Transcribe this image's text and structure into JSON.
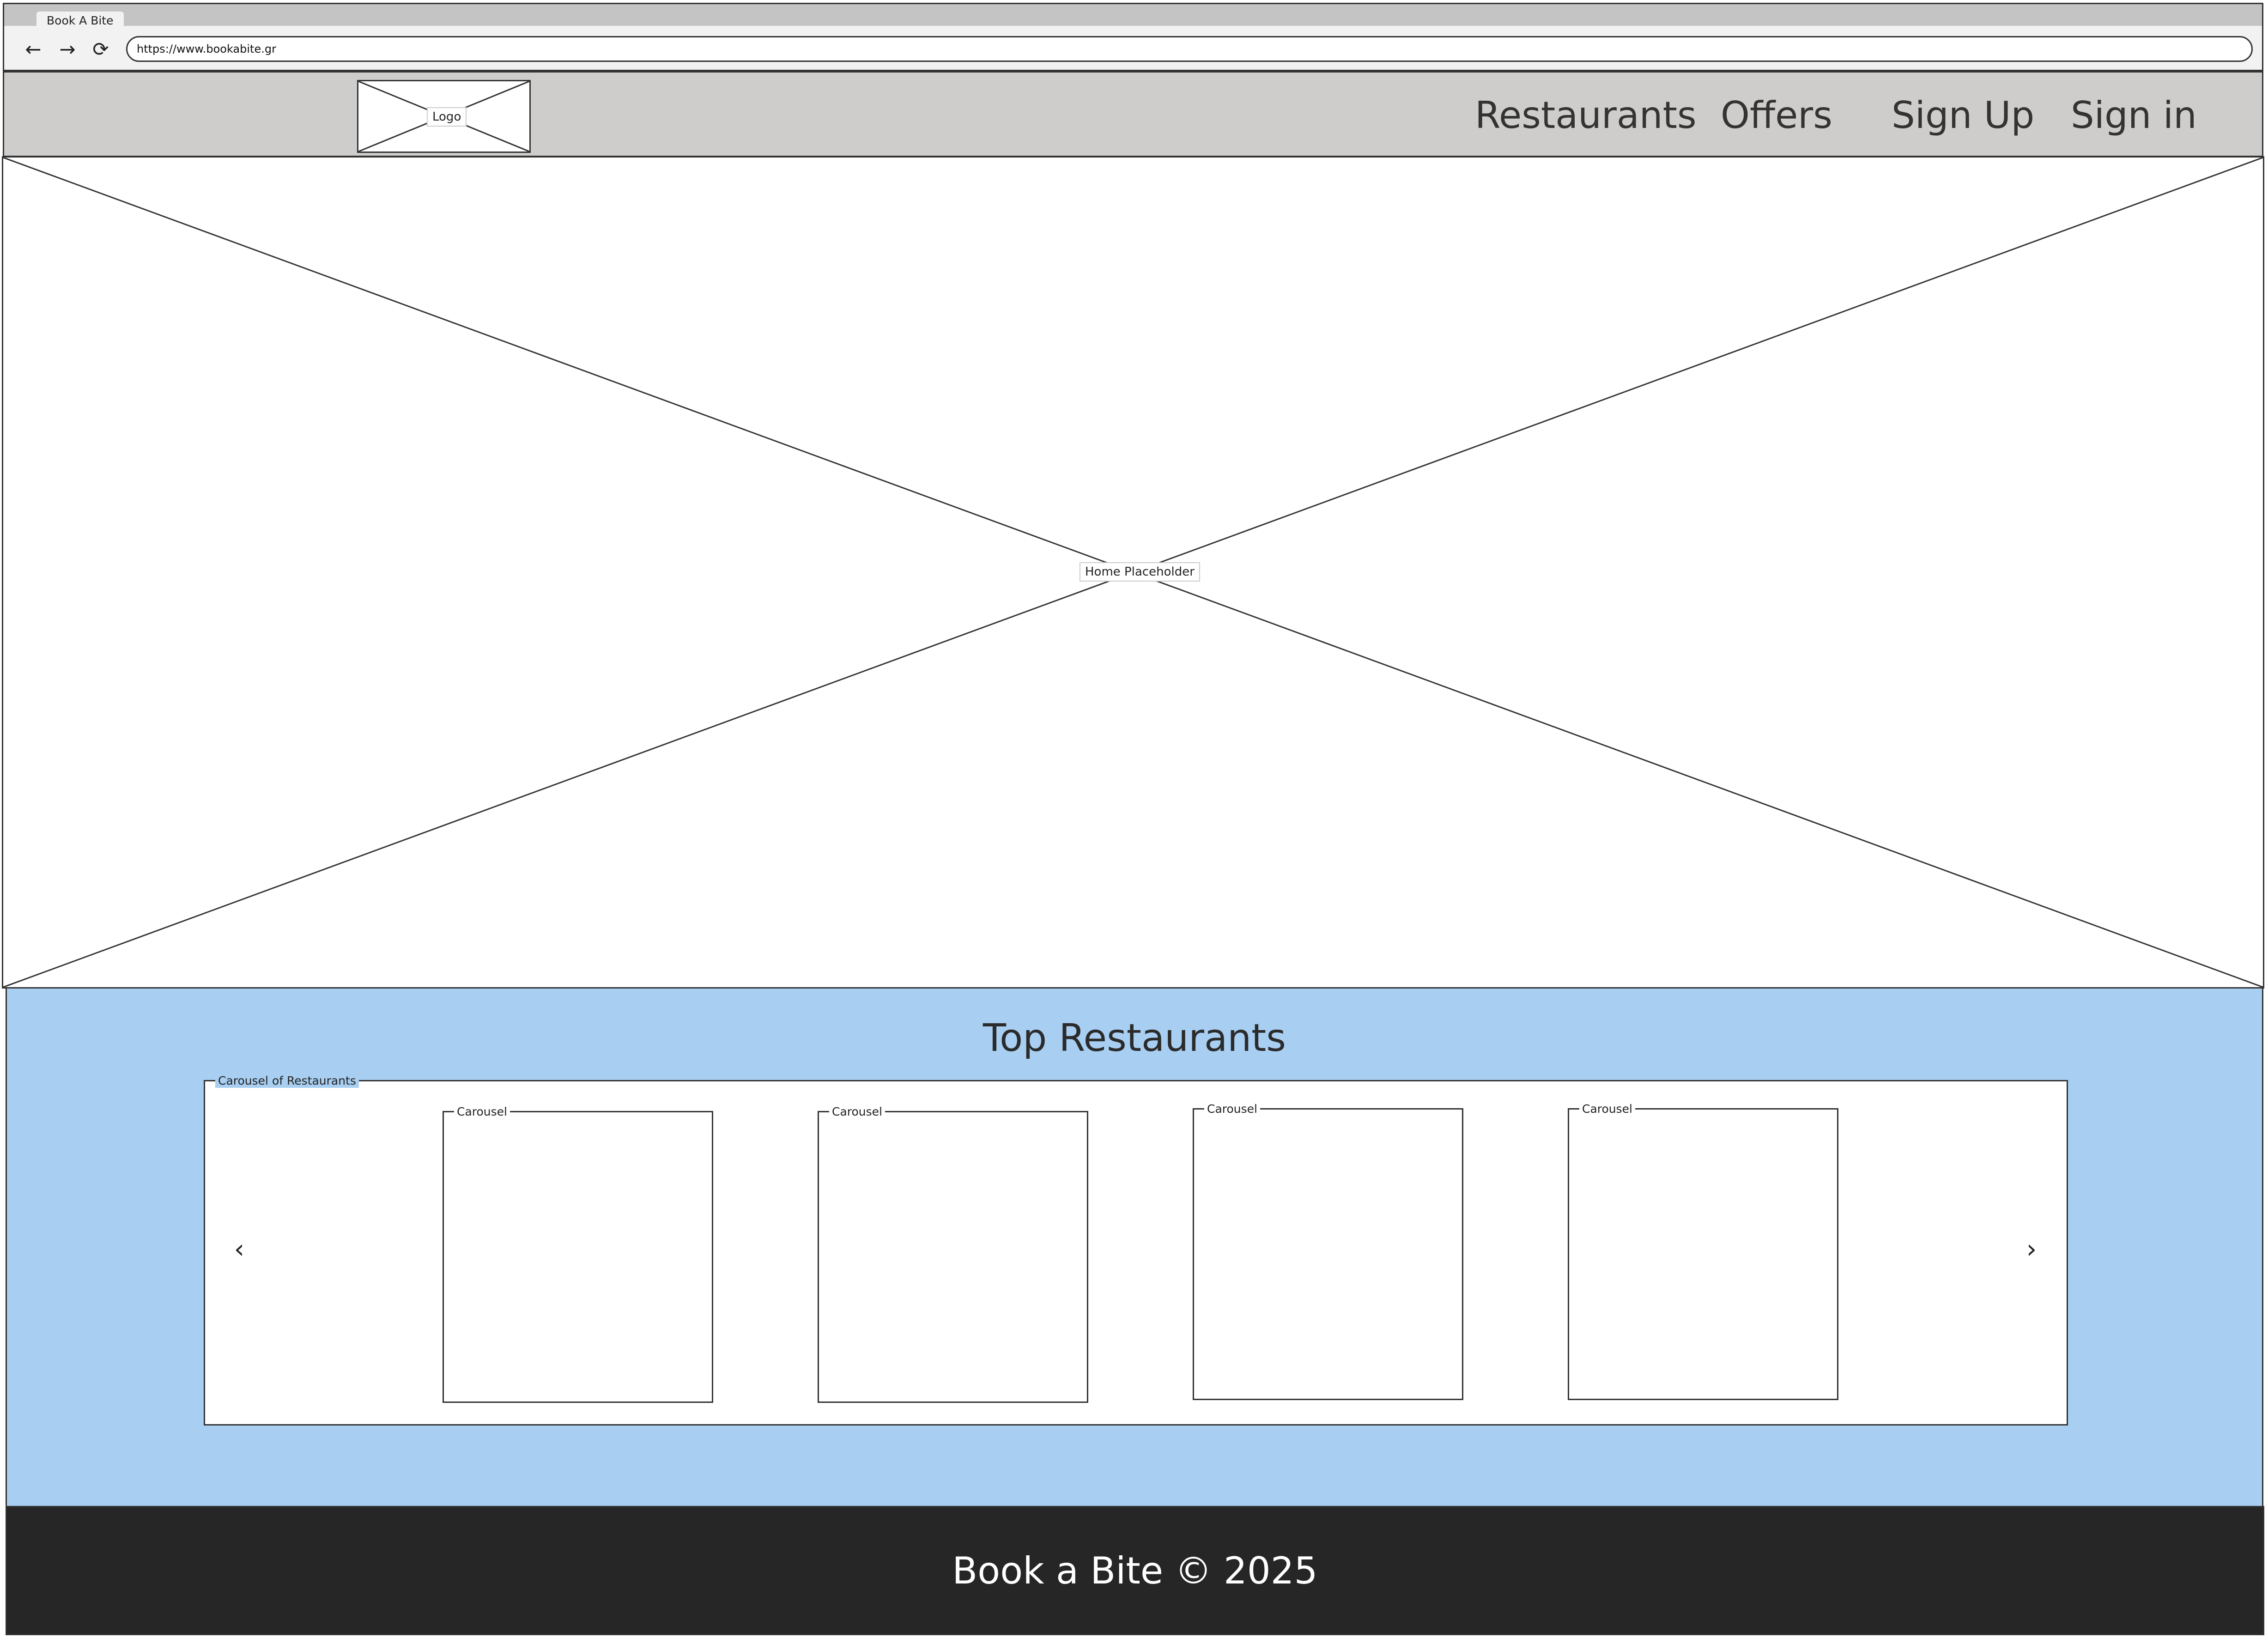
{
  "browser": {
    "tab_title": "Book A Bite",
    "url": "https://www.bookabite.gr",
    "back_icon": "←",
    "forward_icon": "→",
    "reload_icon": "⟳"
  },
  "header": {
    "logo_label": "Logo",
    "nav": {
      "restaurants": "Restaurants",
      "offers": "Offers",
      "sign_up": "Sign Up",
      "sign_in": "Sign in"
    }
  },
  "hero": {
    "label": "Home Placeholder"
  },
  "top_restaurants": {
    "title": "Top Restaurants",
    "container_label": "Carousel of Restaurants",
    "prev_icon": "‹",
    "next_icon": "›",
    "items": [
      {
        "label": "Carousel"
      },
      {
        "label": "Carousel"
      },
      {
        "label": "Carousel"
      },
      {
        "label": "Carousel"
      }
    ]
  },
  "footer": {
    "text": "Book a Bite © 2025"
  },
  "colors": {
    "header_bg": "#cfcdcc",
    "section_bg": "#a8cff2",
    "footer_bg": "#262626"
  }
}
